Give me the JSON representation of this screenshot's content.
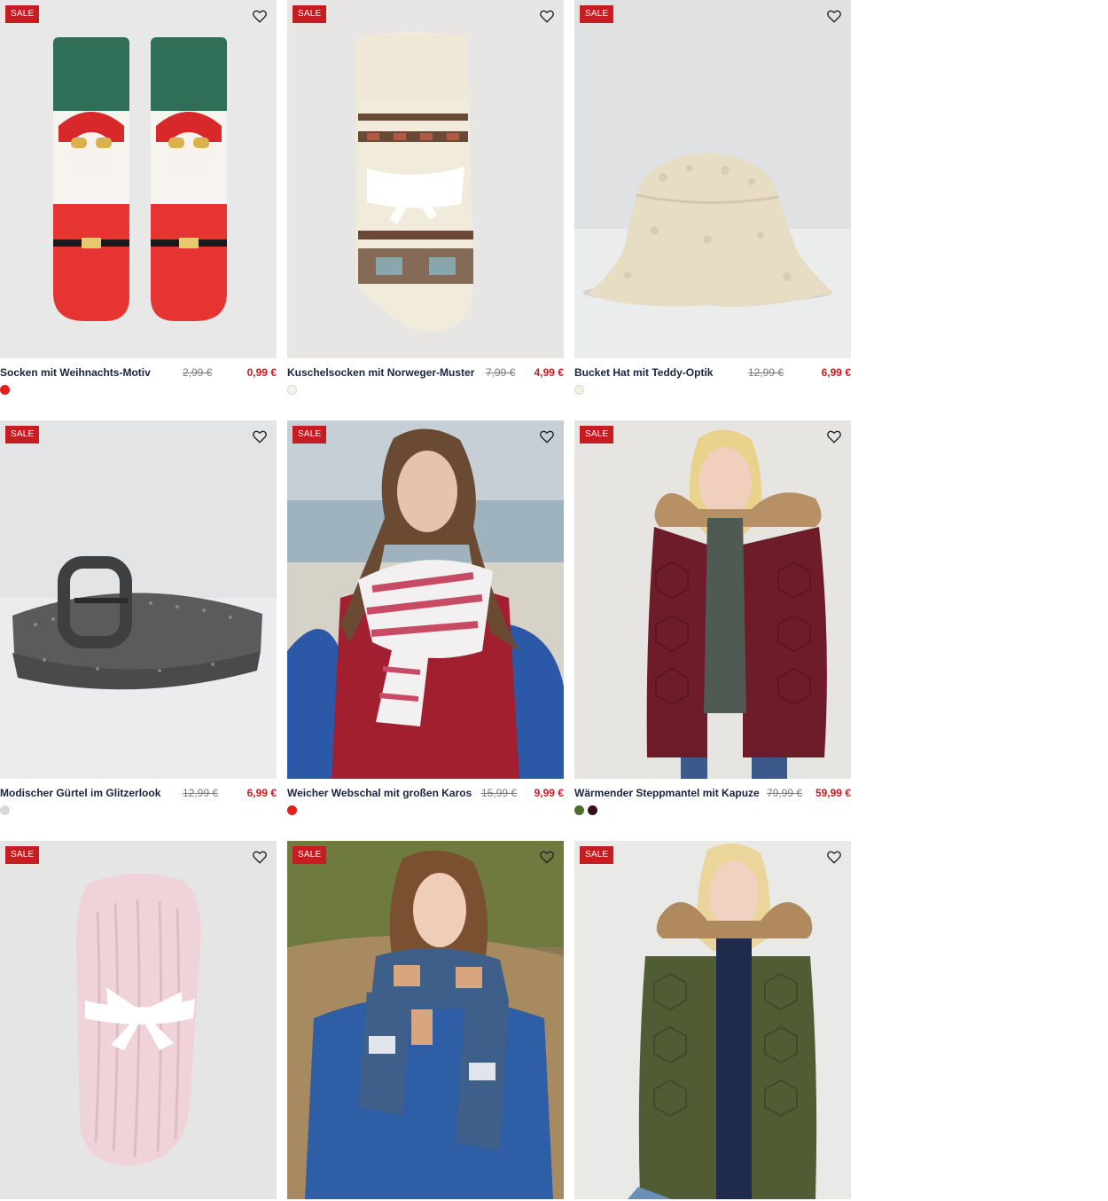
{
  "colors": {
    "sale_badge": "#c61d23",
    "price_new": "#c61d23",
    "price_old": "#7a7a7a",
    "name": "#1a2340"
  },
  "products": [
    {
      "badge": "SALE",
      "name": "Socken mit Weihnachts-Motiv",
      "old_price": "2,99 €",
      "new_price": "0,99 €",
      "swatches": [
        "#e0201d"
      ],
      "image": "santa-socks"
    },
    {
      "badge": "SALE",
      "name": "Kuschelsocken mit Norweger-Muster",
      "old_price": "7,99 €",
      "new_price": "4,99 €",
      "swatches": [
        "#f7f3e6"
      ],
      "image": "nordic-socks"
    },
    {
      "badge": "SALE",
      "name": "Bucket Hat mit Teddy-Optik",
      "old_price": "12,99 €",
      "new_price": "6,99 €",
      "swatches": [
        "#f5efdc"
      ],
      "image": "teddy-bucket-hat"
    },
    {
      "badge": "SALE",
      "name": "Modischer Gürtel im Glitzerlook",
      "old_price": "12,99 €",
      "new_price": "6,99 €",
      "swatches": [
        "#d9d9d9"
      ],
      "image": "glitter-belt"
    },
    {
      "badge": "SALE",
      "name": "Weicher Webschal mit großen Karos",
      "old_price": "15,99 €",
      "new_price": "9,99 €",
      "swatches": [
        "#e0201d"
      ],
      "image": "woman-red-scarf"
    },
    {
      "badge": "SALE",
      "name": "Wärmender Steppmantel mit Kapuze",
      "old_price": "79,99 €",
      "new_price": "59,99 €",
      "swatches": [
        "#4a6e2a",
        "#3a1018"
      ],
      "image": "burgundy-coat"
    },
    {
      "badge": "SALE",
      "image": "pink-socks"
    },
    {
      "badge": "SALE",
      "image": "woman-blue-scarf"
    },
    {
      "badge": "SALE",
      "image": "olive-coat"
    }
  ],
  "icons": {
    "wishlist": "heart-outline-icon"
  }
}
